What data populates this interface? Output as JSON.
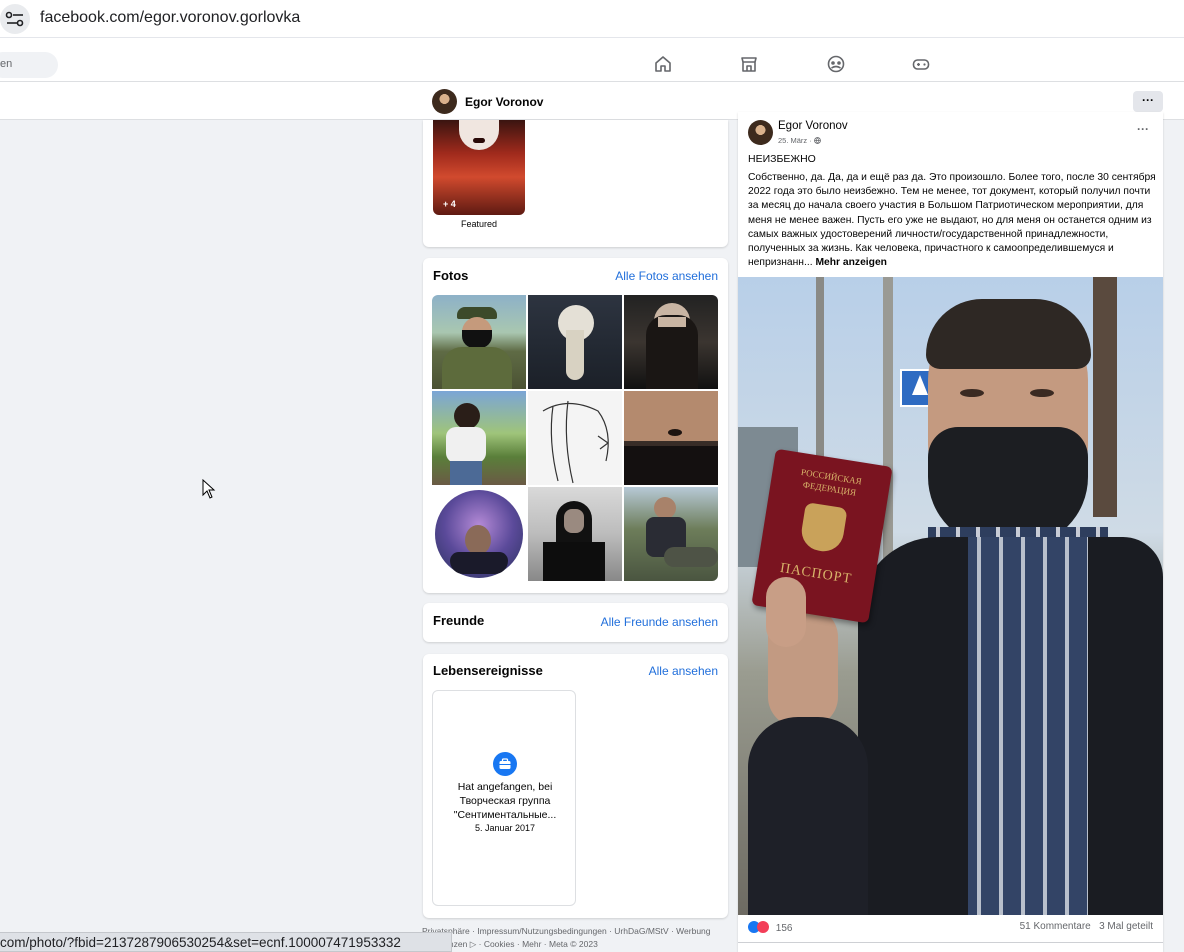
{
  "browser": {
    "url": "facebook.com/egor.voronov.gorlovka",
    "status_url": "com/photo/?fbid=2137287906530254&set=ecnf.100007471953332"
  },
  "nav": {
    "search_partial": "en"
  },
  "profile": {
    "name": "Egor Voronov",
    "more": "···"
  },
  "featured": {
    "count": "+ 4",
    "label": "Featured"
  },
  "fotos": {
    "title": "Fotos",
    "link": "Alle Fotos ansehen"
  },
  "freunde": {
    "title": "Freunde",
    "link": "Alle Freunde ansehen"
  },
  "lebensereignisse": {
    "title": "Lebensereignisse",
    "link": "Alle ansehen",
    "event_text": "Hat angefangen, bei Творческая группа \"Сентиментальные...",
    "event_date": "5. Januar 2017"
  },
  "footer": {
    "line1": "Privatsphäre · Impressum/Nutzungsbedingungen · UrhDaG/MStV · Werbung",
    "line2": "präferenzen ▷ · Cookies · Mehr · Meta © 2023"
  },
  "post": {
    "author": "Egor Voronov",
    "date": "25. März ·",
    "more": "···",
    "title": "НЕИЗБЕЖНО",
    "text": "Собственно, да. Да, да и ещё раз да. Это произошло. Более того, после 30 сентября 2022 года это было неизбежно. Тем не менее, тот документ, который получил почти за месяц до начала своего участия в Большом Патриотическом мероприятии, для меня не менее важен. Пусть его уже не выдают, но для меня он останется одним из самых важных удостоверений личности/государственной принадлежности, полученных за жизнь. Как человека, причастного к самоопределившемуся и непризнанн...",
    "more_link": "Mehr anzeigen",
    "passport_line1": "РОССИЙСКАЯ",
    "passport_line2": "ФЕДЕРАЦИЯ",
    "passport_title": "ПАСПОРТ",
    "reactions": "156",
    "comments": "51 Kommentare",
    "shares": "3 Mal geteilt"
  },
  "colors": {
    "link": "#216fdb",
    "like": "#1877f2",
    "love": "#f33e58",
    "passport": "#7a1420"
  }
}
